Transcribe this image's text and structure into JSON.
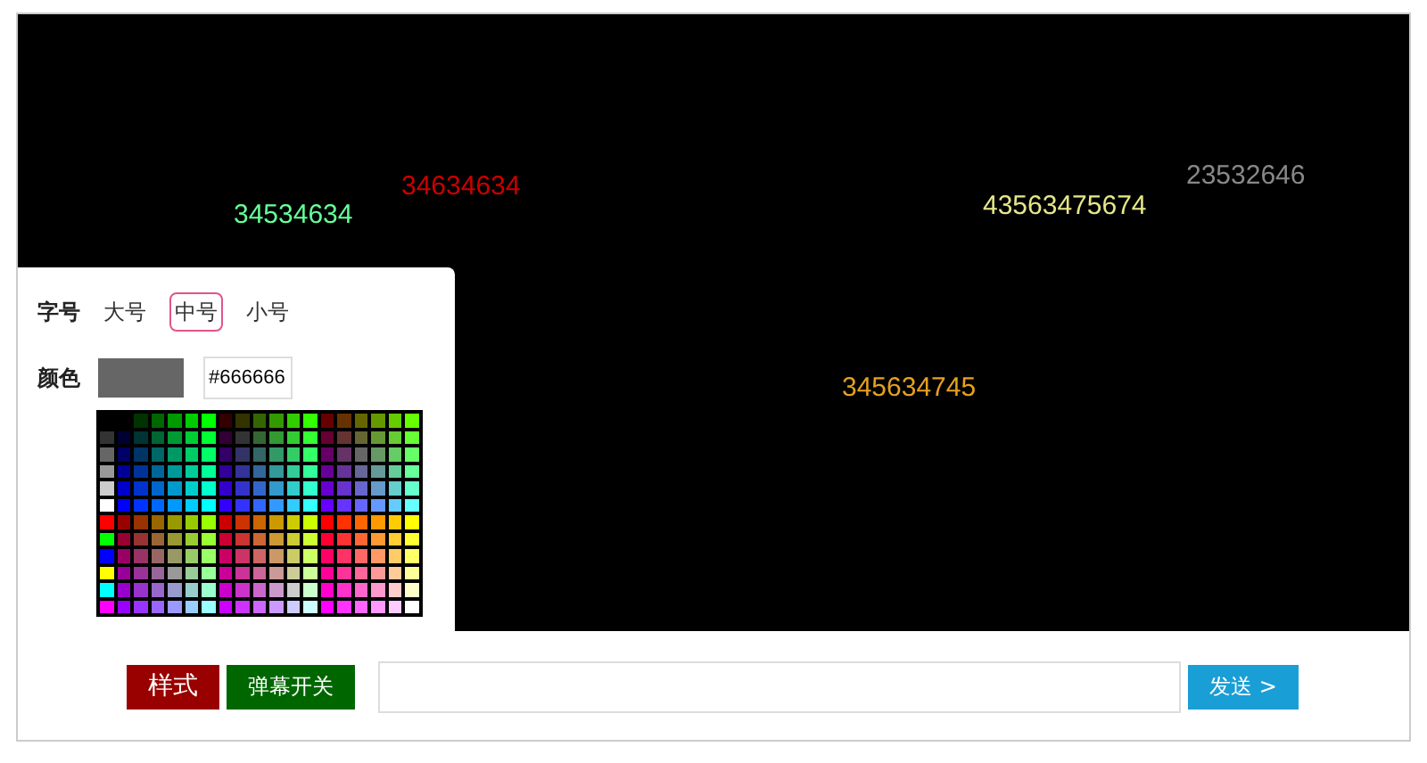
{
  "danmaku": [
    {
      "text": "34534634",
      "color": "#66ff99"
    },
    {
      "text": "34634634",
      "color": "#cc0000"
    },
    {
      "text": "43563475674",
      "color": "#e6e68a"
    },
    {
      "text": "23532646",
      "color": "#888888"
    },
    {
      "text": "345634745",
      "color": "#e6a020"
    }
  ],
  "style_panel": {
    "font_size": {
      "label": "字号",
      "options": [
        {
          "label": "大号",
          "selected": false
        },
        {
          "label": "中号",
          "selected": true
        },
        {
          "label": "小号",
          "selected": false
        }
      ]
    },
    "color": {
      "label": "颜色",
      "value": "#666666"
    }
  },
  "toolbar": {
    "style_button": "样式",
    "toggle_button": "弹幕开关",
    "send_button": "发送 >"
  }
}
